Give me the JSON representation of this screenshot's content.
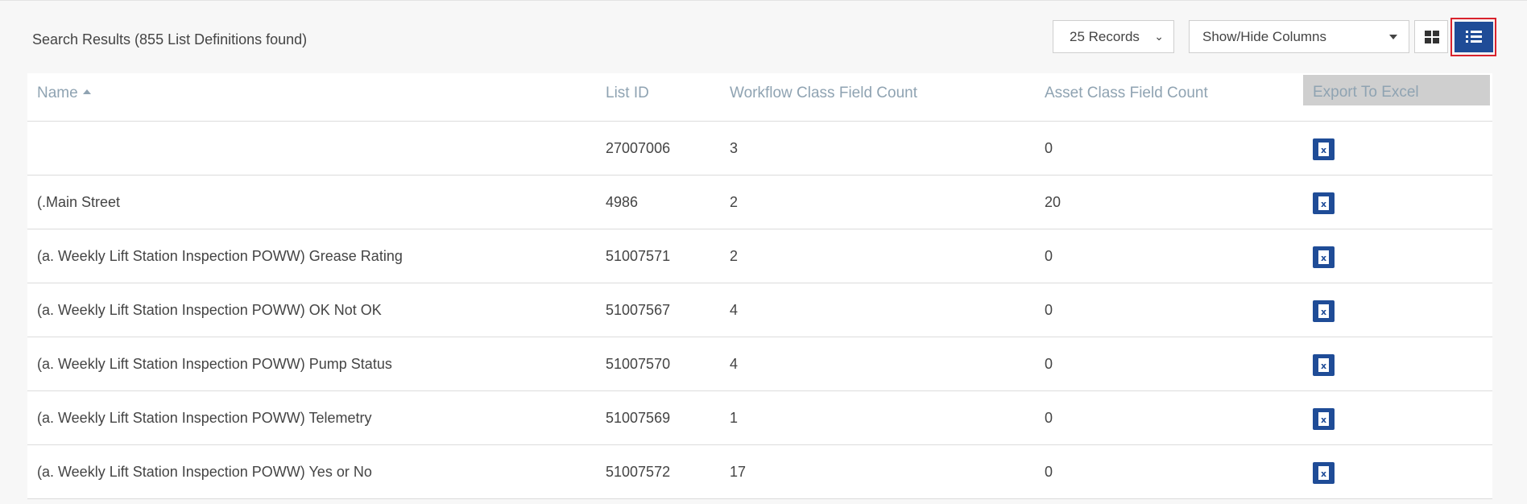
{
  "search": {
    "summary": "Search Results (855 List Definitions found)"
  },
  "toolbar": {
    "records_select": "25 Records",
    "columns_select": "Show/Hide Columns",
    "grid_view_icon": "grid-icon",
    "list_view_icon": "list-icon",
    "active_view": "list",
    "accent_color": "#1f4c97",
    "highlight_color": "#d9232d"
  },
  "table": {
    "headers": {
      "name": "Name",
      "list_id": "List ID",
      "workflow_count": "Workflow Class Field Count",
      "asset_count": "Asset Class Field Count",
      "export": "Export To Excel"
    },
    "sort": {
      "column": "name",
      "direction": "ascending"
    },
    "rows": [
      {
        "name": "",
        "list_id": "27007006",
        "workflow_count": "3",
        "asset_count": "0"
      },
      {
        "name": "(.Main Street",
        "list_id": "4986",
        "workflow_count": "2",
        "asset_count": "20"
      },
      {
        "name": "(a. Weekly Lift Station Inspection POWW) Grease Rating",
        "list_id": "51007571",
        "workflow_count": "2",
        "asset_count": "0"
      },
      {
        "name": "(a. Weekly Lift Station Inspection POWW) OK Not OK",
        "list_id": "51007567",
        "workflow_count": "4",
        "asset_count": "0"
      },
      {
        "name": "(a. Weekly Lift Station Inspection POWW) Pump Status",
        "list_id": "51007570",
        "workflow_count": "4",
        "asset_count": "0"
      },
      {
        "name": "(a. Weekly Lift Station Inspection POWW) Telemetry",
        "list_id": "51007569",
        "workflow_count": "1",
        "asset_count": "0"
      },
      {
        "name": "(a. Weekly Lift Station Inspection POWW) Yes or No",
        "list_id": "51007572",
        "workflow_count": "17",
        "asset_count": "0"
      }
    ],
    "export_icon": "excel-file-icon"
  }
}
